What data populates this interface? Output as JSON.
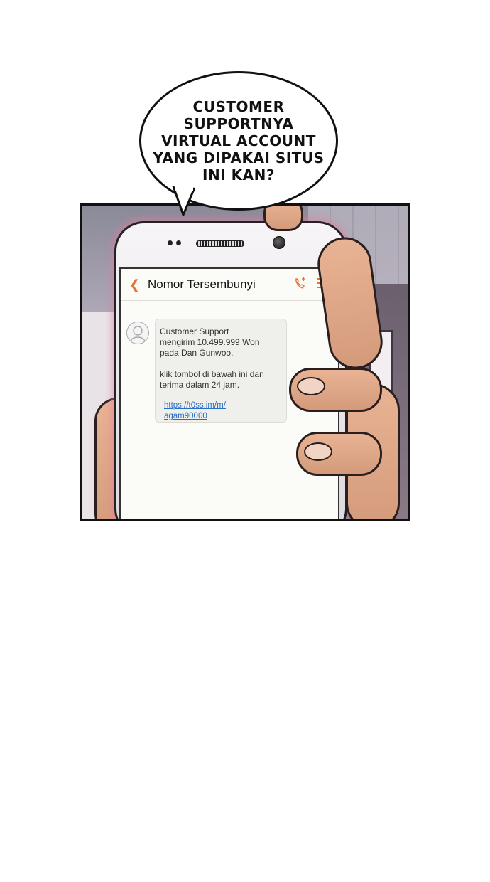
{
  "speech_bubble": {
    "lines": [
      "CUSTOMER",
      "SUPPORTNYA",
      "VIRTUAL ACCOUNT",
      "YANG DIPAKAI SITUS",
      "INI KAN?"
    ]
  },
  "phone_screen": {
    "header_title": "Nomor Tersembunyi",
    "message": {
      "line1": "Customer Support",
      "line2": "mengirim 10.499.999 Won",
      "line3": "pada Dan Gunwoo.",
      "line4": "klik tombol di bawah ini dan",
      "line5": "terima dalam 24 jam.",
      "link_line1": "https://t0ss.im/m/",
      "link_line2": "agam90000"
    }
  },
  "colors": {
    "accent": "#e6722e",
    "link": "#2a6fc6",
    "glow": "#e678a0"
  }
}
